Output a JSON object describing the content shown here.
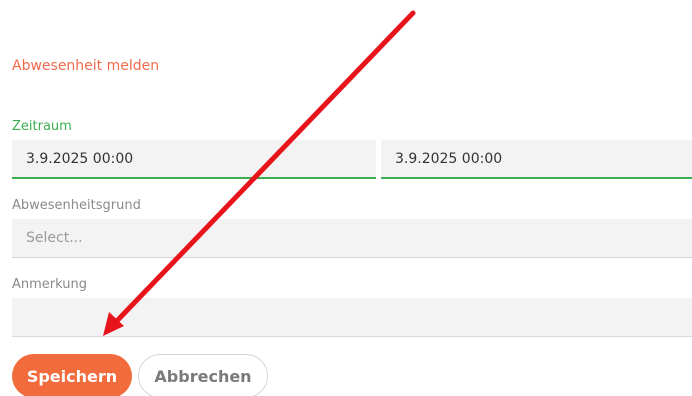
{
  "form": {
    "title": "Abwesenheit melden",
    "period": {
      "label": "Zeitraum",
      "start_value": "3.9.2025 00:00",
      "end_value": "3.9.2025 00:00"
    },
    "reason": {
      "label": "Abwesenheitsgrund",
      "placeholder": "Select..."
    },
    "note": {
      "label": "Anmerkung",
      "value": ""
    },
    "save_label": "Speichern",
    "cancel_label": "Abbrechen"
  },
  "colors": {
    "accent": "#f26b3d",
    "active_field": "#3cae4f",
    "annotation_arrow": "#e8141b"
  }
}
